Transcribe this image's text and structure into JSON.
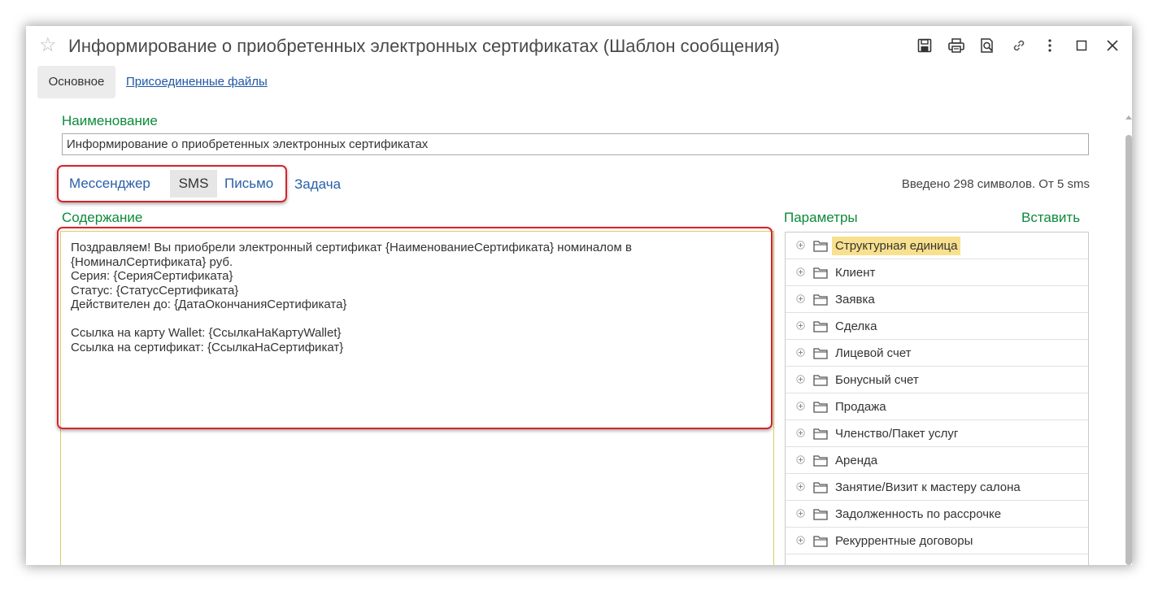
{
  "window": {
    "title": "Информирование о приобретенных электронных сертификатах (Шаблон сообщения)"
  },
  "tabs": [
    {
      "label": "Основное"
    },
    {
      "label": "Присоединенные файлы"
    }
  ],
  "name_field": {
    "label": "Наименование",
    "value": "Информирование о приобретенных электронных сертификатах"
  },
  "channels": [
    {
      "label": "Мессенджер"
    },
    {
      "label": "SMS"
    },
    {
      "label": "Письмо"
    },
    {
      "label": "Задача"
    }
  ],
  "selected_channel": "SMS",
  "counter_text": "Введено 298 символов. От 5 sms",
  "content": {
    "label": "Содержание",
    "lines": [
      "Поздравляем! Вы приобрели электронный сертификат {НаименованиеСертификата} номиналом в",
      "{НоминалСертификата} руб.",
      "Серия: {СерияСертификата}",
      "Статус: {СтатусСертификата}",
      "Действителен до: {ДатаОкончанияСертификата}",
      "",
      "Ссылка на карту Wallet: {СсылкаНаКартуWallet}",
      "Ссылка на сертификат: {СсылкаНаСертификат}"
    ]
  },
  "parameters": {
    "label": "Параметры",
    "insert_label": "Вставить",
    "items": [
      {
        "label": "Структурная единица",
        "icon": "folder-icon",
        "selected": true
      },
      {
        "label": "Клиент",
        "icon": "folder-icon"
      },
      {
        "label": "Заявка",
        "icon": "folder-icon"
      },
      {
        "label": "Сделка",
        "icon": "folder-icon"
      },
      {
        "label": "Лицевой счет",
        "icon": "folder-icon"
      },
      {
        "label": "Бонусный счет",
        "icon": "folder-icon"
      },
      {
        "label": "Продажа",
        "icon": "folder-icon"
      },
      {
        "label": "Членство/Пакет услуг",
        "icon": "folder-icon"
      },
      {
        "label": "Аренда",
        "icon": "folder-icon"
      },
      {
        "label": "Занятие/Визит к мастеру салона",
        "icon": "folder-icon"
      },
      {
        "label": "Задолженность по рассрочке",
        "icon": "folder-icon"
      },
      {
        "label": "Рекуррентные договоры",
        "icon": "folder-icon"
      }
    ]
  },
  "colors": {
    "accent_green": "#0c8a3a",
    "link_blue": "#2a5fa8",
    "highlight_red": "#d8232a",
    "selection_yellow": "#f8e08e"
  }
}
